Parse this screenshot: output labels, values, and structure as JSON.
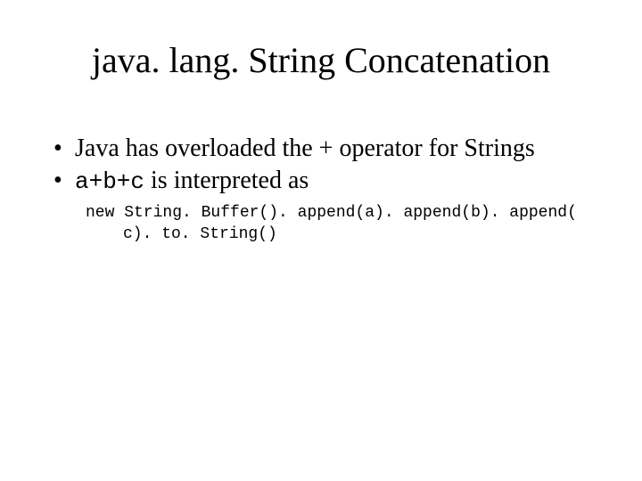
{
  "title": "java. lang. String Concatenation",
  "bullets": [
    {
      "text": "Java has overloaded the + operator for Strings"
    },
    {
      "prefix_code": "a+b+c",
      "suffix_text": " is interpreted as"
    }
  ],
  "code": {
    "line1": "new String. Buffer(). append(a). append(b). append(",
    "line2": "c). to. String()"
  }
}
